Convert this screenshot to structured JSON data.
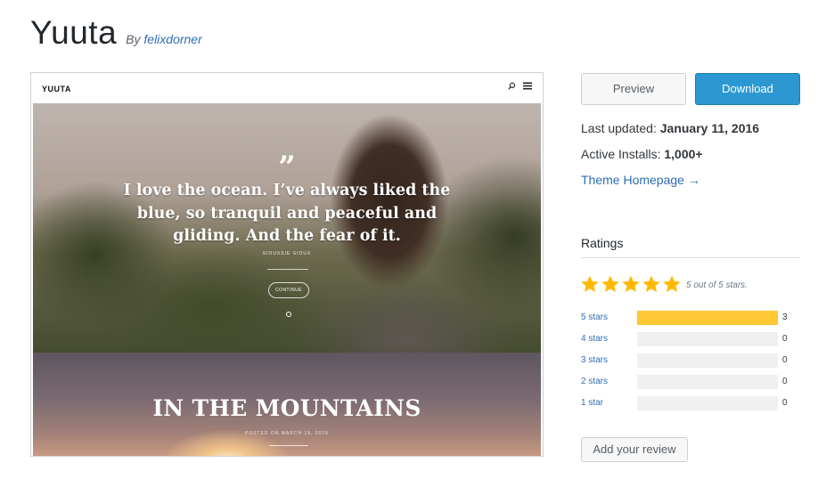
{
  "header": {
    "theme_name": "Yuuta",
    "by_prefix": "By",
    "author": "felixdorner"
  },
  "screenshot": {
    "brand": "YUUTA",
    "quote_mark": "”",
    "quote": "I love the ocean. I’ve always liked the blue, so tranquil and peaceful and gliding. And the fear of it.",
    "quote_author": "SIOUXSIE SIOUX",
    "continue_label": "CONTINUE",
    "post_title": "IN THE MOUNTAINS",
    "post_meta": "POSTED ON MARCH 15, 2016"
  },
  "actions": {
    "preview_label": "Preview",
    "download_label": "Download"
  },
  "meta": {
    "last_updated_label": "Last updated:",
    "last_updated_value": "January 11, 2016",
    "active_installs_label": "Active Installs:",
    "active_installs_value": "1,000+",
    "homepage_link": "Theme Homepage →"
  },
  "ratings": {
    "heading": "Ratings",
    "stars_caption": "5 out of 5 stars.",
    "star_color": "#ffb900",
    "bar_color": "#ffc733",
    "rows": [
      {
        "label": "5 stars",
        "count": "3",
        "fraction": 1.0
      },
      {
        "label": "4 stars",
        "count": "0",
        "fraction": 0
      },
      {
        "label": "3 stars",
        "count": "0",
        "fraction": 0
      },
      {
        "label": "2 stars",
        "count": "0",
        "fraction": 0
      },
      {
        "label": "1 star",
        "count": "0",
        "fraction": 0
      }
    ],
    "add_review_label": "Add your review"
  }
}
